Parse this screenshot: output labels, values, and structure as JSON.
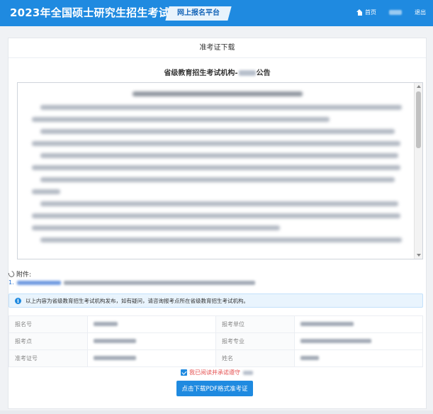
{
  "header": {
    "site_title": "2023年全国硕士研究生招生考试",
    "platform_tag": "网上报名平台",
    "nav": {
      "home": "首页",
      "logout": "退出"
    }
  },
  "page": {
    "card_title": "准考证下载",
    "notice_heading_prefix": "省级教育招生考试机构-",
    "notice_heading_suffix": "公告"
  },
  "attachments": {
    "label": "附件:",
    "items": [
      {
        "index": "1."
      }
    ]
  },
  "info_alert": {
    "text": "以上内容为省级教育招生考试机构发布，如有疑问，请咨询报考点所在省级教育招生考试机构。"
  },
  "info_table": {
    "rows": [
      {
        "label_left": "报名号",
        "label_right": "报考单位"
      },
      {
        "label_left": "报考点",
        "label_right": "报考专业"
      },
      {
        "label_left": "准考证号",
        "label_right": "姓名"
      }
    ]
  },
  "agreement": {
    "text": "我已阅读并承诺遵守"
  },
  "download_button": {
    "label": "点击下载PDF格式准考证"
  },
  "colors": {
    "primary": "#1f8ae0",
    "agree_text": "#e55353",
    "alert_bg": "#e9f4fd"
  }
}
